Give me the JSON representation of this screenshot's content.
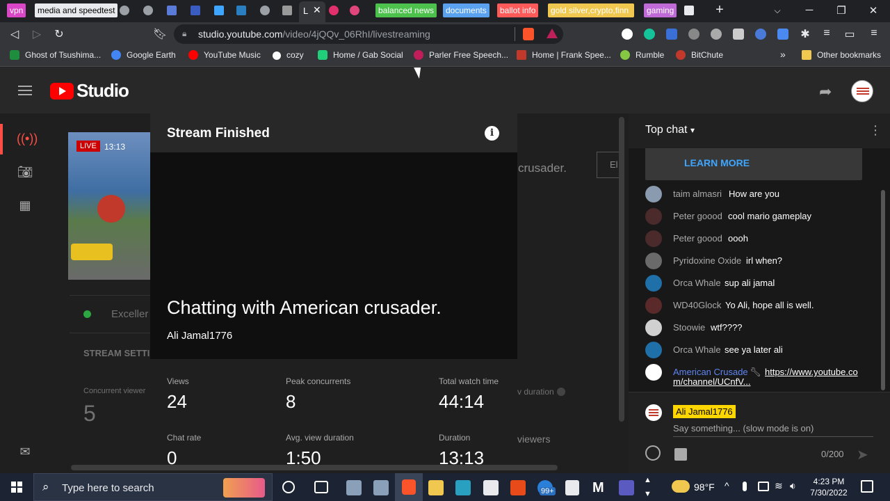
{
  "tabs": [
    {
      "label": "vpn",
      "color": "#d946c6",
      "text_color": "#ffffff"
    },
    {
      "label": "media and speedtest",
      "color": "#e8eaed",
      "text_color": "#000000"
    },
    {
      "label": "balanced news",
      "color": "#4cc24c",
      "text_color": "#ffffff"
    },
    {
      "label": "documents",
      "color": "#5aa2f0",
      "text_color": "#ffffff"
    },
    {
      "label": "ballot info",
      "color": "#ff5a5a",
      "text_color": "#ffffff"
    },
    {
      "label": "gold silver,crypto,finn",
      "color": "#f0c850",
      "text_color": "#ffffff"
    },
    {
      "label": "gaming",
      "color": "#c06ad8",
      "text_color": "#ffffff"
    }
  ],
  "active_tab_label": "L",
  "address": {
    "host": "studio.youtube.com",
    "path": "/video/4jQQv_06RhI/livestreaming"
  },
  "bookmarks": [
    {
      "label": "Ghost of Tsushima...",
      "color": "#1e8e3e"
    },
    {
      "label": "Google Earth",
      "color": "#4285f4"
    },
    {
      "label": "YouTube Music",
      "color": "#ff0000"
    },
    {
      "label": "cozy",
      "color": "#ffffff"
    },
    {
      "label": "Home / Gab Social",
      "color": "#21cf7a"
    },
    {
      "label": "Parler Free Speech...",
      "color": "#bf1e5a"
    },
    {
      "label": "Home | Frank Spee...",
      "color": "#c0392b"
    },
    {
      "label": "Rumble",
      "color": "#85c742"
    },
    {
      "label": "BitChute",
      "color": "#c0392b"
    }
  ],
  "bookmarks_overflow": "»",
  "other_bookmarks": "Other bookmarks",
  "studio": {
    "logo_text": "Studio"
  },
  "background": {
    "live_badge": "LIVE",
    "live_time": "13:13",
    "title_fragment": "crusader.",
    "button_fragment": "El",
    "health_fragment": "Exceller",
    "settings_fragment": "STREAM SETTI",
    "concurrent_fragment": "Concurrent viewer",
    "concurrent_value": "5",
    "duration_fragment": "v duration",
    "viewers_fragment": "viewers"
  },
  "modal": {
    "title": "Stream Finished",
    "info_icon": "i",
    "stream_title": "Chatting with American crusader.",
    "channel": "Ali Jamal1776",
    "stats": [
      {
        "label": "Views",
        "value": "24"
      },
      {
        "label": "Peak concurrents",
        "value": "8"
      },
      {
        "label": "Total watch time",
        "value": "44:14"
      },
      {
        "label": "Chat rate",
        "value": "0"
      },
      {
        "label": "Avg. view duration",
        "value": "1:50"
      },
      {
        "label": "Duration",
        "value": "13:13"
      }
    ]
  },
  "chat": {
    "header": "Top chat",
    "learn_more": "LEARN MORE",
    "messages": [
      {
        "author": "taim almasri",
        "text": "How are you",
        "avatar_color": "#8a9bb0"
      },
      {
        "author": "Peter goood",
        "text": "cool mario gameplay",
        "avatar_color": "#4a2a2a"
      },
      {
        "author": "Peter goood",
        "text": "oooh",
        "avatar_color": "#4a2a2a"
      },
      {
        "author": "Pyridoxine Oxide",
        "text": "irl when?",
        "avatar_color": "#6a6a6a"
      },
      {
        "author": "Orca Whale",
        "text": "sup ali jamal",
        "avatar_color": "#1f6fa8"
      },
      {
        "author": "WD40Glock",
        "text": "Yo Ali, hope all is well.",
        "avatar_color": "#5a2a2a"
      },
      {
        "author": "Stoowie",
        "text": "wtf????",
        "avatar_color": "#d0d0d0"
      },
      {
        "author": "Orca Whale",
        "text": "see ya later ali",
        "avatar_color": "#1f6fa8"
      }
    ],
    "owner_message": {
      "author": "American Crusade",
      "link_line1": "https://www.youtube.co",
      "link_line2": "m/channel/UCnfV..."
    },
    "input": {
      "name": "Ali Jamal1776",
      "placeholder": "Say something... (slow mode is on)",
      "counter": "0/200"
    }
  },
  "taskbar": {
    "search_placeholder": "Type here to search",
    "weather": "98°F",
    "time": "4:23 PM",
    "date": "7/30/2022",
    "mail_badge": "99+"
  }
}
